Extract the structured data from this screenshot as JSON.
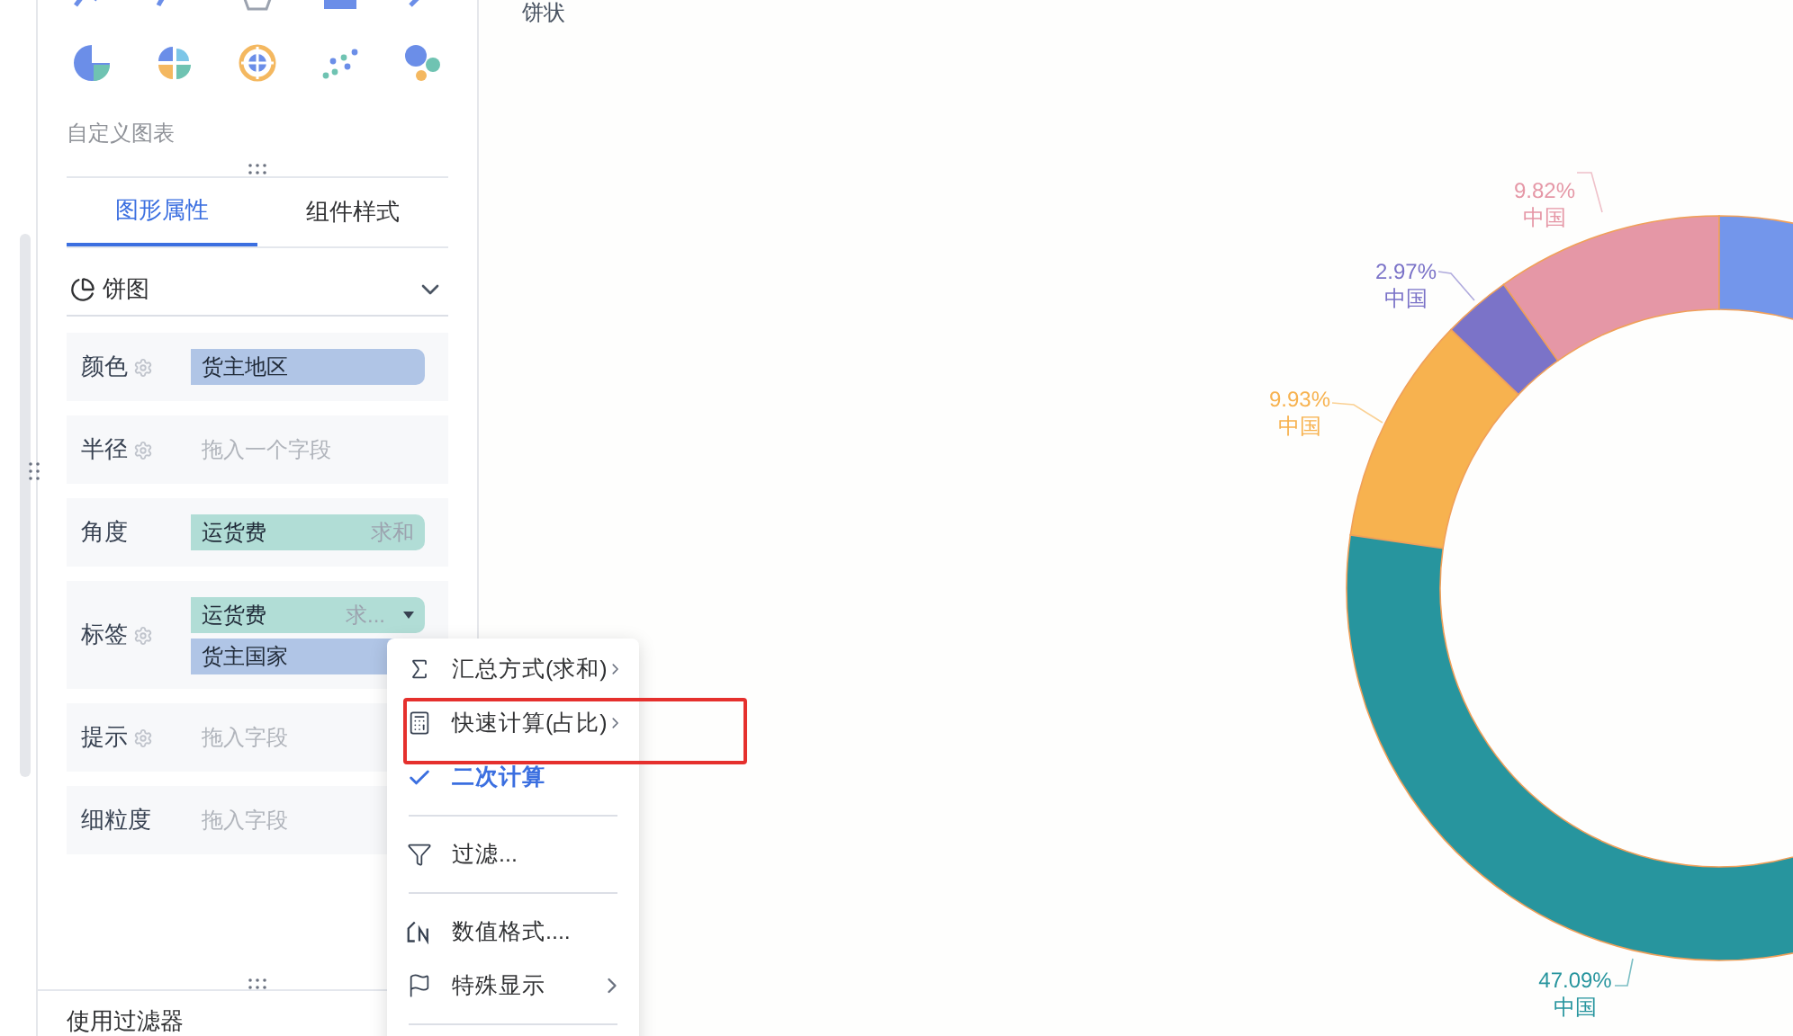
{
  "chart_types": {
    "label": "自定义图表"
  },
  "tabs": [
    {
      "label": "图形属性",
      "selected": true
    },
    {
      "label": "组件样式",
      "selected": false
    }
  ],
  "chart_select": {
    "value": "饼图"
  },
  "fields": [
    {
      "label": "颜色",
      "settings": true,
      "pills": [
        {
          "text": "货主地区",
          "kind": "dimension"
        }
      ]
    },
    {
      "label": "半径",
      "settings": true,
      "placeholder": "拖入一个字段"
    },
    {
      "label": "角度",
      "settings": false,
      "pills": [
        {
          "text": "运货费",
          "kind": "measure",
          "agg": "求和",
          "dropdown": false
        }
      ]
    },
    {
      "label": "标签",
      "settings": true,
      "pills": [
        {
          "text": "运货费",
          "kind": "measure",
          "agg": "求...",
          "dropdown": true
        },
        {
          "text": "货主国家",
          "kind": "dimension"
        }
      ]
    },
    {
      "label": "提示",
      "settings": true,
      "placeholder": "拖入字段"
    },
    {
      "label": "细粒度",
      "settings": false,
      "placeholder": "拖入字段"
    }
  ],
  "filter_section": {
    "label": "使用过滤器"
  },
  "context_menu": {
    "items": [
      {
        "kind": "item",
        "label": "汇总方式(求和)",
        "submenu": true,
        "checked": false,
        "highlighted": false
      },
      {
        "kind": "item",
        "label": "快速计算(占比)",
        "submenu": true,
        "checked": false,
        "highlighted": true
      },
      {
        "kind": "item",
        "label": "二次计算",
        "submenu": false,
        "checked": true,
        "highlighted": false
      },
      {
        "kind": "divider"
      },
      {
        "kind": "item",
        "label": "过滤...",
        "submenu": false,
        "checked": false,
        "highlighted": false
      },
      {
        "kind": "divider"
      },
      {
        "kind": "item",
        "label": "数值格式....",
        "submenu": false,
        "checked": false,
        "highlighted": false
      },
      {
        "kind": "item",
        "label": "特殊显示",
        "submenu": true,
        "checked": false,
        "highlighted": false
      },
      {
        "kind": "divider"
      }
    ]
  },
  "canvas": {
    "title": "饼状",
    "chart_data": {
      "type": "donut",
      "categories": [
        "中国",
        "中国",
        "中国",
        "中国",
        null
      ],
      "values": [
        9.82,
        2.97,
        9.93,
        47.09,
        30.19
      ],
      "value_labels": [
        "9.82%",
        "2.97%",
        "9.93%",
        "47.09%",
        null
      ],
      "colors": [
        "#e597a6",
        "#7b73c8",
        "#f7b24f",
        "#27959e",
        "#7396eb"
      ]
    }
  }
}
